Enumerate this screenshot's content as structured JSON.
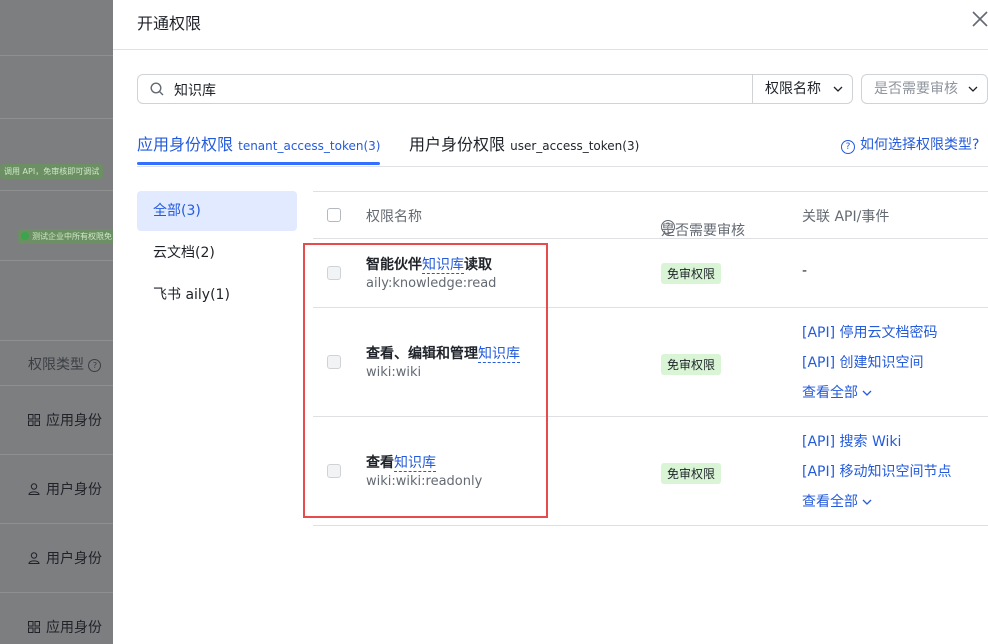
{
  "background": {
    "tag_api": "调用 API，免审核即可调试",
    "tag_test": "测试企业中所有权限免",
    "perm_type_label": "权限类型",
    "rows": [
      "应用身份",
      "用户身份",
      "用户身份",
      "应用身份"
    ]
  },
  "dialog": {
    "title": "开通权限",
    "search": {
      "value": "知识库",
      "placeholder": ""
    },
    "filter_name": "权限名称",
    "filter_review": "是否需要审核",
    "tabs": [
      {
        "label": "应用身份权限",
        "token": "tenant_access_token(3)"
      },
      {
        "label": "用户身份权限",
        "token": "user_access_token(3)"
      }
    ],
    "help_link": "如何选择权限类型?",
    "categories": [
      "全部(3)",
      "云文档(2)",
      "飞书 aily(1)"
    ],
    "columns": {
      "name": "权限名称",
      "review": "是否需要审核",
      "api": "关联 API/事件"
    },
    "rows": [
      {
        "name_pre": "智能伙伴",
        "name_hl": "知识库",
        "name_post": "读取",
        "code": "aily:knowledge:read",
        "badge": "免审权限",
        "apis": [],
        "dash": "-",
        "more": ""
      },
      {
        "name_pre": "查看、编辑和管理",
        "name_hl": "知识库",
        "name_post": "",
        "code": "wiki:wiki",
        "badge": "免审权限",
        "apis": [
          "[API] 停用云文档密码",
          "[API] 创建知识空间"
        ],
        "dash": "",
        "more": "查看全部"
      },
      {
        "name_pre": "查看",
        "name_hl": "知识库",
        "name_post": "",
        "code": "wiki:wiki:readonly",
        "badge": "免审权限",
        "apis": [
          "[API] 搜索 Wiki",
          "[API] 移动知识空间节点"
        ],
        "dash": "",
        "more": "查看全部"
      }
    ]
  },
  "colors": {
    "accent": "#245bdb",
    "highlight_box": "#e64c4c",
    "badge_bg": "#d9f5d6"
  }
}
